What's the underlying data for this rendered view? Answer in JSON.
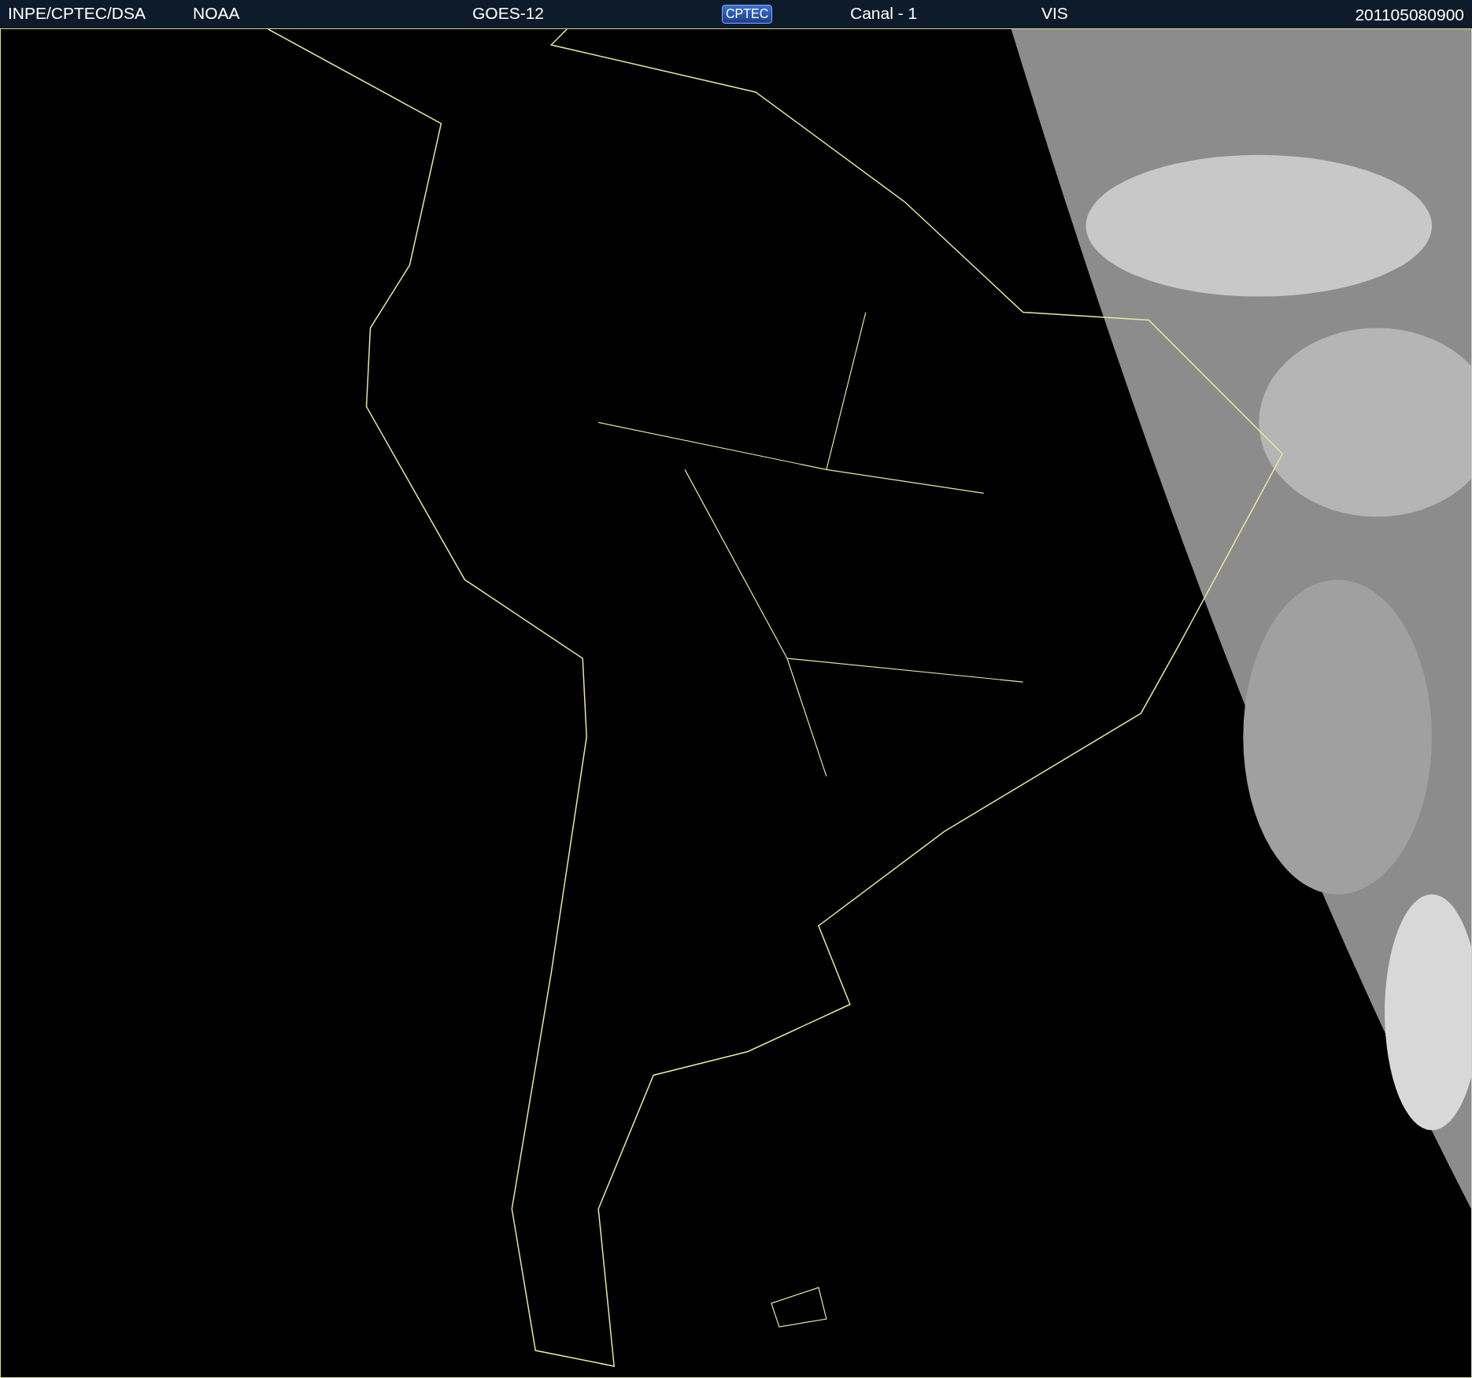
{
  "header": {
    "institution": "INPE/CPTEC/DSA",
    "agency": "NOAA",
    "satellite": "GOES-12",
    "logo": "CPTEC",
    "channel": "Canal - 1",
    "band": "VIS",
    "timestamp": "201105080900"
  }
}
